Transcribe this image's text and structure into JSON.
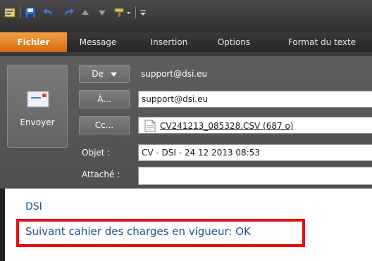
{
  "quick_access": {
    "icons": [
      "app-icon",
      "save-icon",
      "undo-icon",
      "redo-icon",
      "arrow-up-icon",
      "arrow-down-icon",
      "format-painter-icon",
      "customize-icon"
    ]
  },
  "tabs": [
    "Fichier",
    "Message",
    "Insertion",
    "Options",
    "Format du texte"
  ],
  "header": {
    "send_label": "Envoyer",
    "from_button": "De",
    "from_value": "support@dsi.eu",
    "to_button": "À...",
    "to_value": "support@dsi.eu",
    "cc_button": "Cc...",
    "cc_value": "",
    "subject_label": "Objet :",
    "subject_value": "CV - DSI - 24 12 2013 08:53",
    "attached_label": "Attaché :",
    "attachment": "CV241213_085328.CSV (687 o)"
  },
  "body": {
    "line1": "DSI",
    "line2": "Suivant cahier des charges en vigueur: OK"
  },
  "colors": {
    "accent_tab": "#e07a1a",
    "header_bg": "#575757",
    "body_text": "#1f4e8c",
    "highlight": "#e31010"
  }
}
